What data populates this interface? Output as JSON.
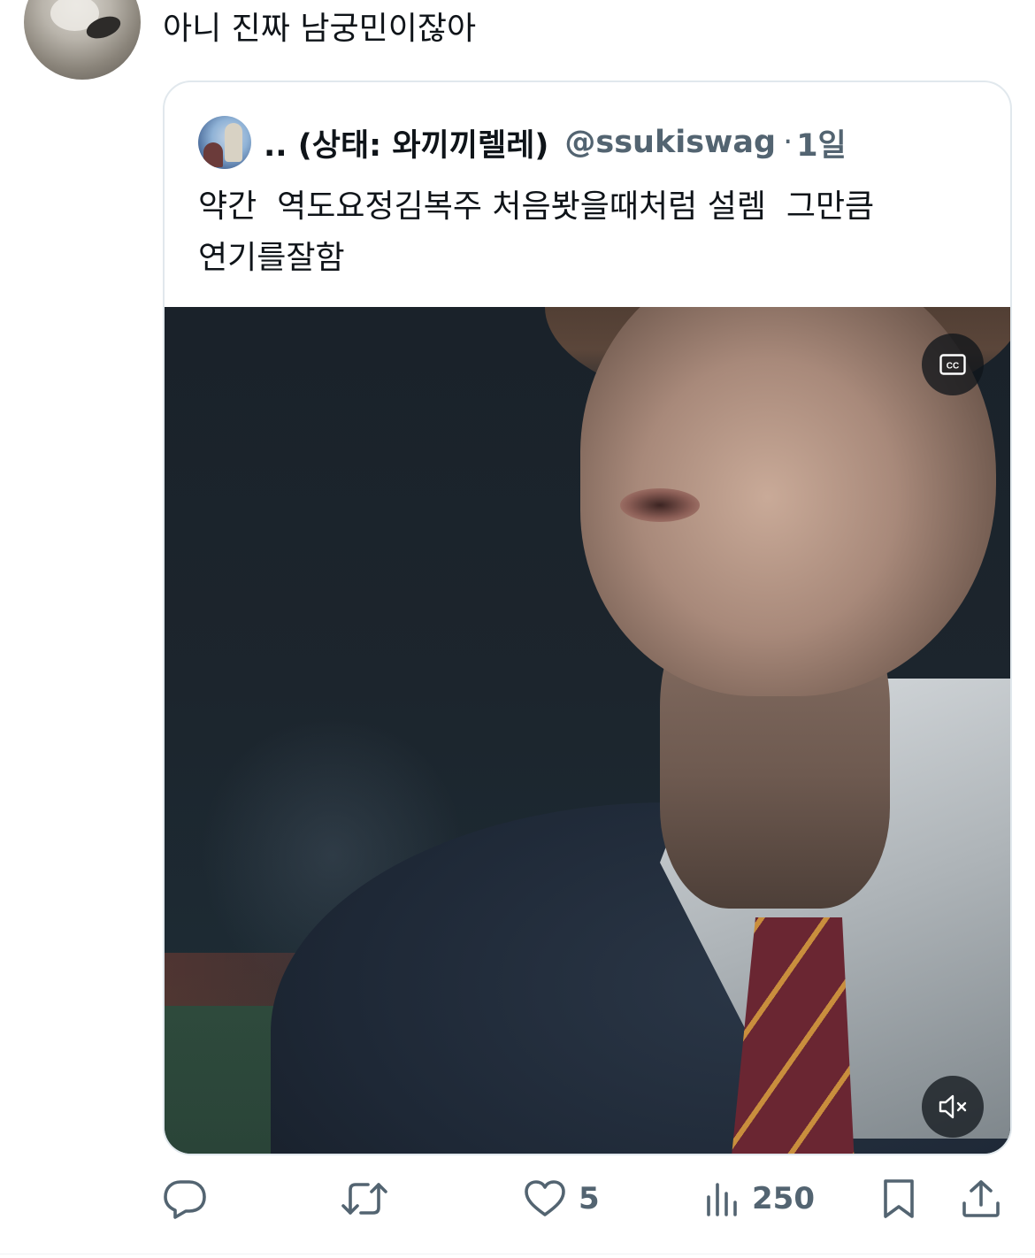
{
  "reply": {
    "text": "아니 진짜 남궁민이잖아"
  },
  "quote": {
    "display_name": ".. (상태: 와끼끼렐레)",
    "handle": "@ssukiswag",
    "separator": "·",
    "time": "1일",
    "body": "약간  역도요정김복주 처음봣을때처럼 설렘  그만큼\n연기를잘함",
    "video": {
      "cc_icon": "closed-captions-icon",
      "mute_icon": "volume-muted-icon"
    }
  },
  "actions": {
    "reply_icon": "reply-icon",
    "retweet_icon": "retweet-icon",
    "like_icon": "heart-icon",
    "like_count": "5",
    "views_icon": "views-chart-icon",
    "views_count": "250",
    "bookmark_icon": "bookmark-icon",
    "share_icon": "share-icon"
  },
  "colors": {
    "text_primary": "#0f1419",
    "text_secondary": "#536471",
    "card_border": "#e1e8ed"
  }
}
